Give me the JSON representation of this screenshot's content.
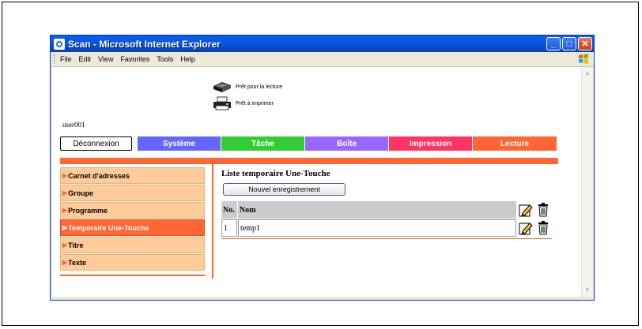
{
  "window": {
    "title": "Scan - Microsoft Internet Explorer",
    "controls": [
      "_",
      "□",
      "✕"
    ]
  },
  "menu": [
    "File",
    "Edit",
    "View",
    "Favorites",
    "Tools",
    "Help"
  ],
  "status": {
    "ready_read": "Prêt pour la lecture",
    "ready_print": "Prêt à imprimer"
  },
  "user": "user001",
  "tabs": {
    "logout": "Déconnexion",
    "items": [
      {
        "label": "Système",
        "color": "#6666FF"
      },
      {
        "label": "Tâche",
        "color": "#33CC33"
      },
      {
        "label": "Boîte",
        "color": "#9966FF"
      },
      {
        "label": "Impression",
        "color": "#FF3366"
      },
      {
        "label": "Lecture",
        "color": "#FF6633"
      }
    ]
  },
  "sidebar": {
    "items": [
      {
        "label": "Carnet d'adresses"
      },
      {
        "label": "Groupe"
      },
      {
        "label": "Programme"
      },
      {
        "label": "Temporaire Une-Touche"
      },
      {
        "label": "Titre"
      },
      {
        "label": "Texte"
      }
    ],
    "active_index": 3
  },
  "main": {
    "title": "Liste temporaire Une-Touche",
    "new_button": "Nouvel enregistrement",
    "table": {
      "headers": [
        "No.",
        "Nom"
      ],
      "rows": [
        {
          "no": "1",
          "name": "temp1"
        }
      ]
    }
  },
  "colors": {
    "accent": "#FF6633",
    "sidebar_bg": "#FFCC99",
    "xp_title": "#0A5FEB"
  }
}
